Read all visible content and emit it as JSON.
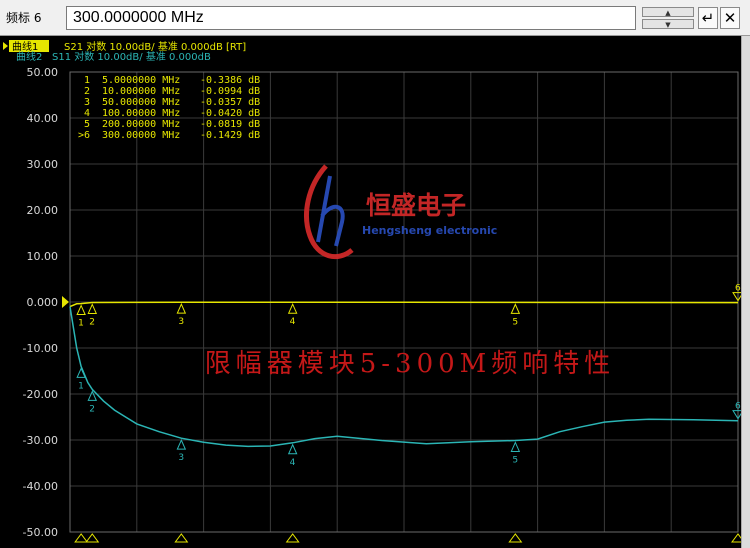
{
  "toolbar": {
    "marker_label": "频标 6",
    "frequency_value": "300.0000000 MHz",
    "enter_glyph": "↵",
    "close_glyph": "✕",
    "spin_up_glyph": "▲",
    "spin_down_glyph": "▼"
  },
  "traces": [
    {
      "tag": "曲线1",
      "info": "S21 对数 10.00dB/ 基准 0.000dB [RT]",
      "color": "#e6e600",
      "tag_bg": "#e6e600",
      "tag_fg": "#000000"
    },
    {
      "tag": "曲线2",
      "info": "S11 对数 10.00dB/ 基准 0.000dB",
      "color": "#2bb5b5"
    }
  ],
  "marker_table": [
    {
      "id": "1",
      "freq": "5.0000000 MHz",
      "value": "-0.3386 dB"
    },
    {
      "id": "2",
      "freq": "10.000000 MHz",
      "value": "-0.0994 dB"
    },
    {
      "id": "3",
      "freq": "50.000000 MHz",
      "value": "-0.0357 dB"
    },
    {
      "id": "4",
      "freq": "100.00000 MHz",
      "value": "-0.0420 dB"
    },
    {
      "id": "5",
      "freq": "200.00000 MHz",
      "value": "-0.0819 dB"
    },
    {
      "id": ">6",
      "freq": "300.00000 MHz",
      "value": "-0.1429 dB"
    }
  ],
  "logo": {
    "cn_text": "恒盛电子",
    "en_text": "Hengsheng electronic",
    "color": "#d42a2a",
    "accent": "#2a4fbf"
  },
  "overlay_title": "限幅器模块5-300M频响特性",
  "overlay_color": "#c41818",
  "chart_data": {
    "type": "line",
    "title": "",
    "xlabel": "",
    "ylabel": "",
    "xlim": [
      0,
      300
    ],
    "ylim": [
      -50,
      50
    ],
    "y_ticks": [
      "50.00",
      "40.00",
      "30.00",
      "20.00",
      "10.00",
      "0.000",
      "-10.00",
      "-20.00",
      "-30.00",
      "-40.00",
      "-50.00"
    ],
    "reference_level": 0,
    "grid": true,
    "series": [
      {
        "name": "S21",
        "color": "#e6e600",
        "x": [
          0,
          3,
          5,
          10,
          50,
          100,
          150,
          200,
          250,
          300
        ],
        "y": [
          -1.0,
          -0.4,
          -0.34,
          -0.1,
          -0.04,
          -0.04,
          -0.05,
          -0.08,
          -0.11,
          -0.14
        ]
      },
      {
        "name": "S11",
        "color": "#2bb5b5",
        "x": [
          0,
          3,
          5,
          8,
          10,
          15,
          20,
          30,
          40,
          50,
          60,
          70,
          80,
          90,
          100,
          110,
          120,
          140,
          160,
          180,
          200,
          210,
          220,
          230,
          240,
          250,
          260,
          280,
          300
        ],
        "y": [
          -1,
          -10,
          -14,
          -17.5,
          -19,
          -21.5,
          -23.5,
          -26.5,
          -28.2,
          -29.6,
          -30.5,
          -31.1,
          -31.4,
          -31.3,
          -30.6,
          -29.7,
          -29.2,
          -30.1,
          -30.8,
          -30.4,
          -30.1,
          -29.8,
          -28.2,
          -27.1,
          -26.1,
          -25.7,
          -25.5,
          -25.6,
          -25.8
        ]
      }
    ],
    "markers": [
      {
        "id": "1",
        "label": "1",
        "x": 5,
        "s21": -0.3386,
        "s11": -14
      },
      {
        "id": "2",
        "label": "2",
        "x": 10,
        "s21": -0.0994,
        "s11": -19
      },
      {
        "id": "3",
        "label": "3",
        "x": 50,
        "s21": -0.0357,
        "s11": -29.6
      },
      {
        "id": "4",
        "label": "4",
        "x": 100,
        "s21": -0.042,
        "s11": -30.6
      },
      {
        "id": "5",
        "label": "5",
        "x": 200,
        "s21": -0.0819,
        "s11": -30.1
      },
      {
        "id": "6",
        "label": "6",
        "x": 300,
        "s21": -0.1429,
        "s11": -25.8
      }
    ]
  }
}
